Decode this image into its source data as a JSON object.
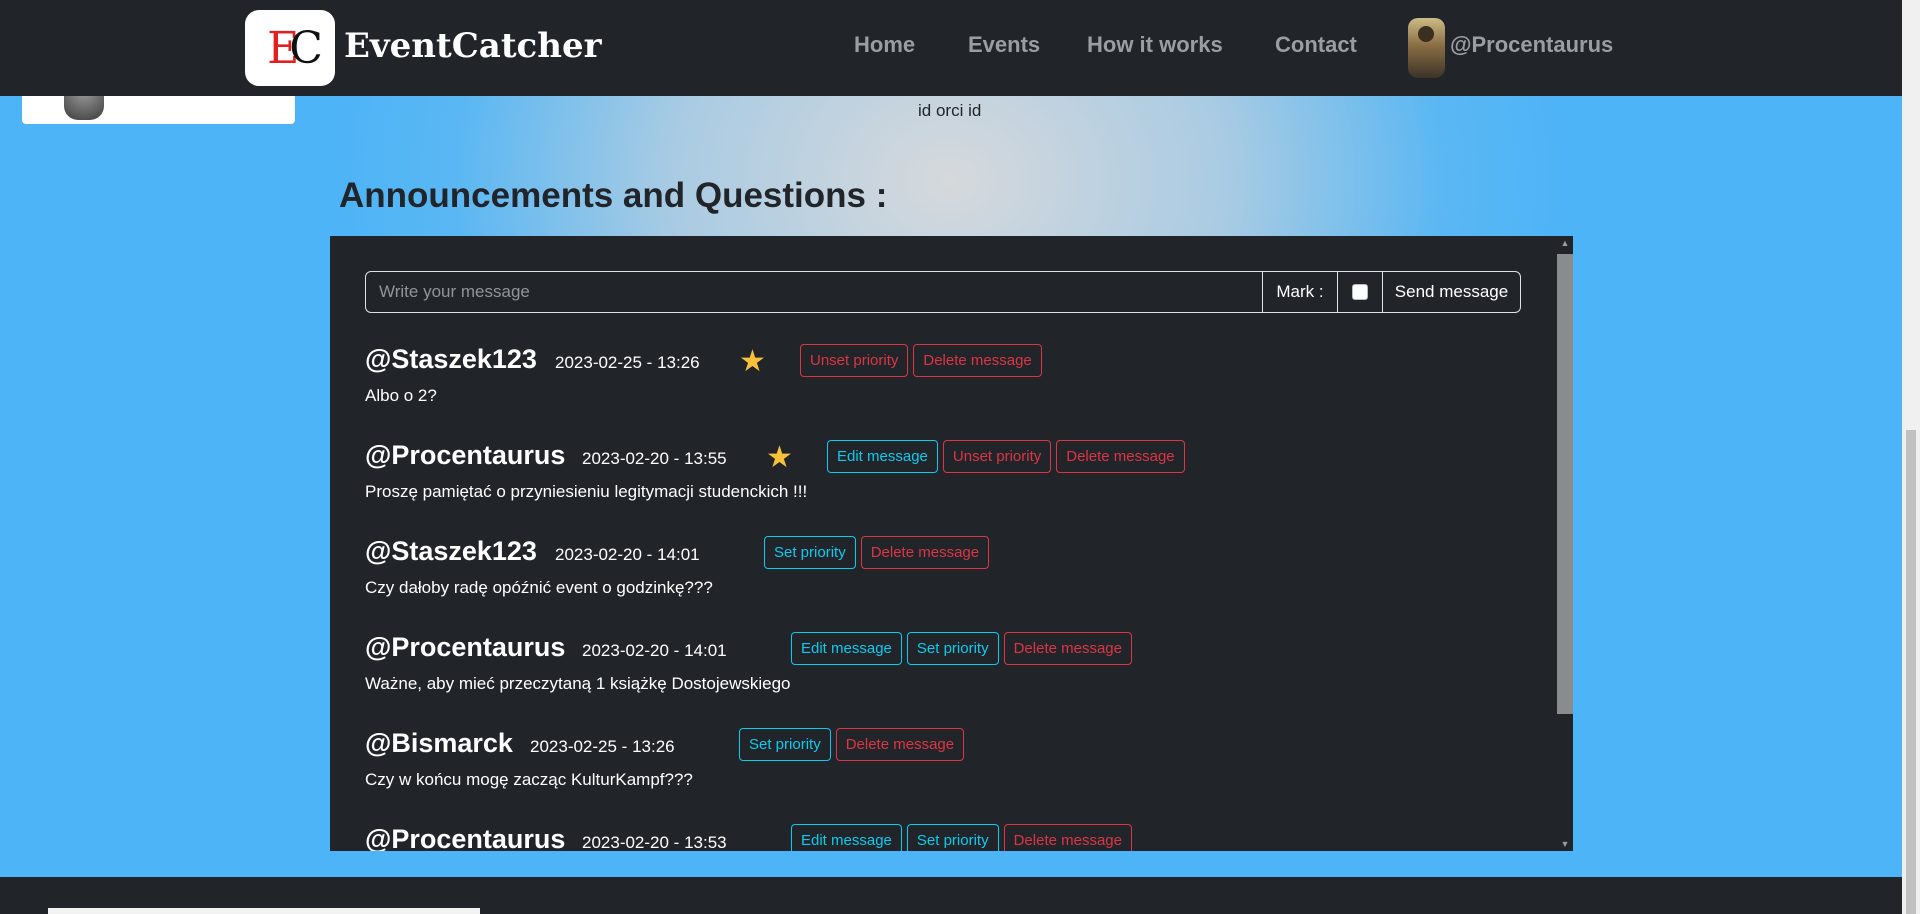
{
  "navbar": {
    "brand": "EventCatcher",
    "logo_text_e": "E",
    "logo_text_c": "C",
    "links": [
      "Home",
      "Events",
      "How it works",
      "Contact"
    ],
    "user": "@Procentaurus"
  },
  "event": {
    "description_tail": "id orci id"
  },
  "chat": {
    "title": "Announcements and Questions :",
    "placeholder": "Write your message",
    "mark_label": "Mark :",
    "send_label": "Send message",
    "messages": [
      {
        "author": "@Staszek123",
        "date": "2023-02-25 - 13:26",
        "starred": true,
        "text": "Albo o 2?",
        "buttons": [
          {
            "label": "Unset priority",
            "style": "danger"
          },
          {
            "label": "Delete message",
            "style": "danger"
          }
        ]
      },
      {
        "author": "@Procentaurus",
        "date": "2023-02-20 - 13:55",
        "starred": true,
        "text": "Proszę pamiętać o przyniesieniu legitymacji studenckich !!!",
        "buttons": [
          {
            "label": "Edit message",
            "style": "info"
          },
          {
            "label": "Unset priority",
            "style": "danger"
          },
          {
            "label": "Delete message",
            "style": "danger"
          }
        ]
      },
      {
        "author": "@Staszek123",
        "date": "2023-02-20 - 14:01",
        "starred": false,
        "text": "Czy dałoby radę opóźnić event o godzinkę???",
        "buttons": [
          {
            "label": "Set priority",
            "style": "info"
          },
          {
            "label": "Delete message",
            "style": "danger"
          }
        ]
      },
      {
        "author": "@Procentaurus",
        "date": "2023-02-20 - 14:01",
        "starred": false,
        "text": "Ważne, aby mieć przeczytaną 1 książkę Dostojewskiego",
        "buttons": [
          {
            "label": "Edit message",
            "style": "info"
          },
          {
            "label": "Set priority",
            "style": "info"
          },
          {
            "label": "Delete message",
            "style": "danger"
          }
        ]
      },
      {
        "author": "@Bismarck",
        "date": "2023-02-25 - 13:26",
        "starred": false,
        "text": "Czy w końcu mogę zacząc KulturKampf???",
        "buttons": [
          {
            "label": "Set priority",
            "style": "info"
          },
          {
            "label": "Delete message",
            "style": "danger"
          }
        ]
      },
      {
        "author": "@Procentaurus",
        "date": "2023-02-20 - 13:53",
        "starred": false,
        "text": "",
        "buttons": [
          {
            "label": "Edit message",
            "style": "info"
          },
          {
            "label": "Set priority",
            "style": "info"
          },
          {
            "label": "Delete message",
            "style": "danger"
          }
        ]
      }
    ]
  },
  "colors": {
    "navbar_bg": "#212529",
    "panel_bg": "#212529",
    "info": "#0dcaf0",
    "danger": "#dc3545",
    "star": "#f7c23a",
    "page_bg": "#4db4f7"
  }
}
